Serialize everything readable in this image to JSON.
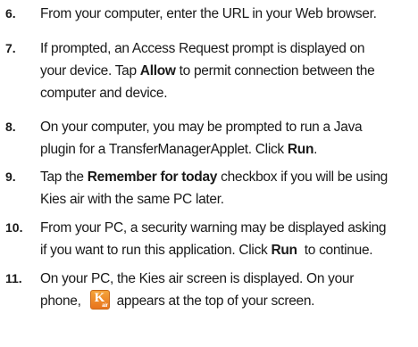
{
  "steps": [
    {
      "number": "6.",
      "lines": [
        "From your computer, enter the URL in your Web browser."
      ]
    },
    {
      "number": "7.",
      "line1": "If prompted, an Access Request prompt is displayed on",
      "line2_pre": "your device. Tap ",
      "line2_bold": "Allow",
      "line2_post": " to permit connection between the",
      "line3": "computer and device."
    },
    {
      "number": "8.",
      "line1": "On your computer, you may be prompted to run a Java",
      "line2_pre": "plugin for a TransferManagerApplet. Click ",
      "line2_bold": "Run",
      "line2_post": "."
    },
    {
      "number": "9.",
      "line1_pre": "Tap the ",
      "line1_bold": "Remember for today",
      "line1_post": " checkbox if you will be using",
      "line2": "Kies air with the same PC later."
    },
    {
      "number": "10.",
      "line1": "From your PC, a security warning may be displayed asking",
      "line2_pre": "if you want to run this application. Click ",
      "line2_bold": "Run",
      "line2_post": "  to continue."
    },
    {
      "number": "11.",
      "line1": "On your PC, the Kies air screen is displayed. On your",
      "line2_pre": "phone,",
      "line2_post": "appears at the top of your screen.",
      "icon": "kies-air-icon",
      "icon_letter": "K",
      "icon_sub": "air"
    }
  ]
}
